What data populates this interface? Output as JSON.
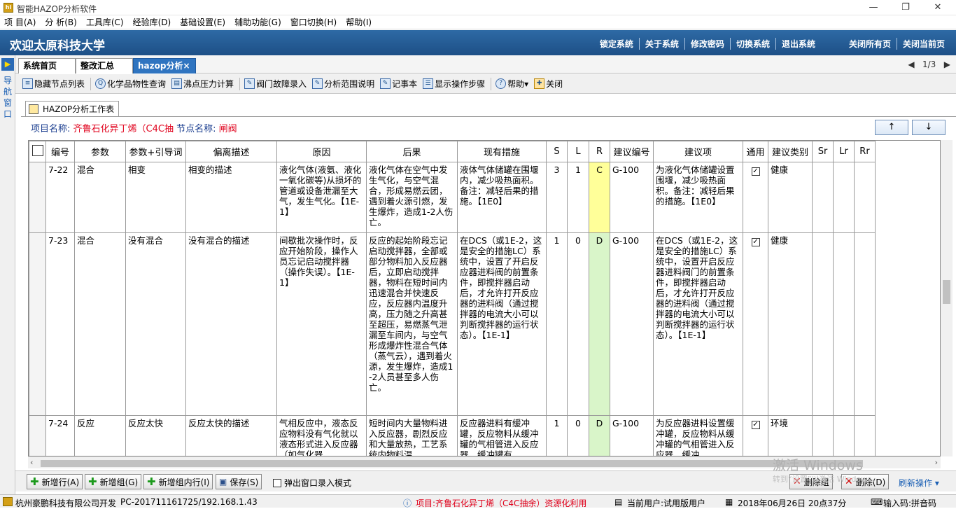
{
  "window": {
    "title": "智能HAZOP分析软件",
    "minimize": "—",
    "restore": "❐",
    "close": "✕"
  },
  "menu": [
    "项 目(A)",
    "分 析(B)",
    "工具库(C)",
    "经验库(D)",
    "基础设置(E)",
    "辅助功能(G)",
    "窗口切换(H)",
    "帮助(I)"
  ],
  "header": {
    "welcome": "欢迎太原科技大学",
    "links": [
      "锁定系统",
      "关于系统",
      "修改密码",
      "切换系统",
      "退出系统",
      "关闭所有页",
      "关闭当前页"
    ]
  },
  "leftnav": {
    "label": "导航窗口"
  },
  "tabs": [
    {
      "label": "系统首页"
    },
    {
      "label": "整改汇总"
    },
    {
      "label": "hazop分析"
    }
  ],
  "tab_close": "×",
  "tab_pager": {
    "prev": "◀",
    "page": "1/3",
    "next": "▶"
  },
  "toolbar": [
    {
      "label": "隐藏节点列表",
      "icon": "list-icon"
    },
    {
      "label": "化学品物性查询",
      "icon": "search-icon"
    },
    {
      "label": "沸点压力计算",
      "icon": "document-icon"
    },
    {
      "label": "阀门故障录入",
      "icon": "edit-icon"
    },
    {
      "label": "分析范围说明",
      "icon": "edit-icon"
    },
    {
      "label": "记事本",
      "icon": "notepad-icon"
    },
    {
      "label": "显示操作步骤",
      "icon": "steps-icon"
    },
    {
      "label": "帮助▾",
      "icon": "help-icon"
    },
    {
      "label": "关闭",
      "icon": "close-icon"
    }
  ],
  "worktab": {
    "label": "HAZOP分析工作表"
  },
  "project": {
    "name_label": "项目名称:",
    "name": "齐鲁石化异丁烯（C4C‌抽",
    "node_label": "节点名称:",
    "node": "闸阀"
  },
  "sort_buttons": {
    "up": "↑",
    "down": "↓"
  },
  "table": {
    "columns": [
      "",
      "编号",
      "参数",
      "参数+引导词",
      "偏离描述",
      "原因",
      "后果",
      "现有措施",
      "S",
      "L",
      "R",
      "建议编号",
      "建议项",
      "通用",
      "建议类别",
      "Sr",
      "Lr",
      "Rr"
    ],
    "rows": [
      {
        "id": "7-22",
        "param": "混合",
        "guideword": "相变",
        "deviation": "相变的描述",
        "cause": "液化气体(液氨、液化一氧化碳等)从损坏的管道或设备泄漏至大气，发生气化。【1E-1】",
        "consequence": "液化气体在空气中发生气化，与空气混合，形成易燃云团，遇到着火源引燃，发生爆炸，造成1-2人伤亡。",
        "measures": "液体气体储罐在围堰内，减少吸热面积。备注：减轻后果的措施。【1E0】",
        "s": "3",
        "l": "1",
        "r": "C",
        "rec_id": "G-100",
        "rec": "为液化气体储罐设置围堰，减少吸热面积。备注：减轻后果的措施。【1E0】",
        "general": "✓",
        "category": "健康",
        "sr": "",
        "lr": "",
        "rr": ""
      },
      {
        "id": "7-23",
        "param": "混合",
        "guideword": "没有混合",
        "deviation": "没有混合的描述",
        "cause": "间歇批次操作时，反应开始阶段，操作人员忘记启动搅拌器（操作失误）。【1E-1】",
        "consequence": "反应的起始阶段忘记启动搅拌器，全部或部分物料加入反应器后，立即启动搅拌器，物料在短时间内迅速混合并快速反应，反应器内温度升高，压力随之升高甚至超压，易燃蒸气泄漏至车间内，与空气形成爆炸性混合气体（蒸气云），遇到着火源，发生爆炸，造成1-2人员甚至多人伤亡。",
        "measures": "在DCS（或1E-2，这是安全的措施LC）系统中，设置了开启反应器进料阀的前置条件，即搅拌器启动后，才允许打开反应器的进料阀（通过搅拌器的电流大小可以判断搅拌器的运行状态）。【1E-1】",
        "s": "1",
        "l": "0",
        "r": "D",
        "rec_id": "G-100",
        "rec": "在DCS（或1E-2，这是安全的措施LC）系统中，设置开启反应器进料阀门的前置条件，即搅拌器启动后，才允许打开反应器的进料阀（通过搅拌器的电流大小可以判断搅拌器的运行状态）。【1E-1】",
        "general": "✓",
        "category": "健康",
        "sr": "",
        "lr": "",
        "rr": ""
      },
      {
        "id": "7-24",
        "param": "反应",
        "guideword": "反应太快",
        "deviation": "反应太快的描述",
        "cause": "气相反应中，液态反应物料没有气化就以液态形式进入反应器（如气化器",
        "consequence": "短时间内大量物料进入反应器，剧烈反应和大量放热，工艺系统内物料温",
        "measures": "反应器进料有缓冲罐，反应物料从缓冲罐的气相管进入反应器，缓冲罐有",
        "s": "1",
        "l": "0",
        "r": "D",
        "rec_id": "G-100",
        "rec": "为反应器进料设置缓冲罐，反应物料从缓冲罐的气相管进入反应器，缓冲",
        "general": "✓",
        "category": "环境",
        "sr": "",
        "lr": "",
        "rr": ""
      }
    ]
  },
  "bottom_buttons": {
    "add_row": "新增行(A)",
    "add_group": "新增组(G)",
    "add_in_group": "新增组内行(I)",
    "save": "保存(S)",
    "popup_mode": "弹出窗口录入模式",
    "delete_group": "删除组",
    "delete": "删除(D)",
    "refresh": "刷新操作"
  },
  "watermark": {
    "title": "激活 Windows",
    "sub": "转到“设置”以激活 Windows。"
  },
  "status": {
    "company": "杭州豪鹏科技有限公司开发",
    "pc": "PC-201711161725/192.168.1.43",
    "project": "项目:齐鲁石化异丁烯（C4C抽余）资源化利用",
    "user": "当前用户:试用版用户",
    "datetime": "2018年06月26日 20点37分",
    "ime": "输入码:拼音码"
  },
  "colors": {
    "header_bg": "#1d4f86",
    "accent_tab": "#2f74c0",
    "risk_c": "#ffff99",
    "risk_d": "#d9f5c9",
    "project_value": "#e0001b"
  }
}
